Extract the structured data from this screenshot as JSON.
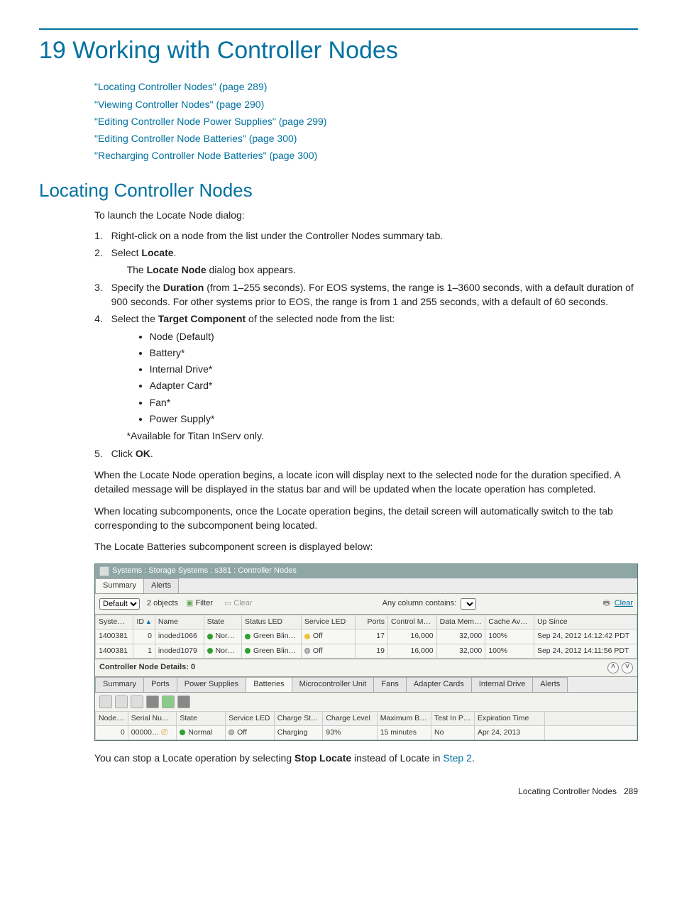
{
  "chapter": {
    "title": "19 Working with Controller Nodes"
  },
  "toc": [
    "\"Locating Controller Nodes\" (page 289)",
    "\"Viewing Controller Nodes\" (page 290)",
    "\"Editing Controller Node Power Supplies\" (page 299)",
    "\"Editing Controller Node Batteries\" (page 300)",
    "\"Recharging Controller Node Batteries\" (page 300)"
  ],
  "section1": {
    "heading": "Locating Controller Nodes",
    "intro": "To launch the Locate Node dialog:",
    "step1": "Right-click on a node from the list under the Controller Nodes summary tab.",
    "step2_pre": "Select ",
    "step2_bold": "Locate",
    "step2_post": ".",
    "step2_sub_pre": "The ",
    "step2_sub_bold": "Locate Node",
    "step2_sub_post": " dialog box appears.",
    "step3_pre": "Specify the ",
    "step3_bold": "Duration",
    "step3_post": " (from 1–255 seconds). For EOS systems, the range is 1–3600 seconds, with a default duration of 900 seconds. For other systems prior to EOS, the range is from 1 and 255 seconds, with a default of 60 seconds.",
    "step4_pre": "Select the ",
    "step4_bold": "Target Component",
    "step4_post": " of the selected node from the list:",
    "bullets": [
      "Node (Default)",
      "Battery*",
      "Internal Drive*",
      "Adapter Card*",
      "Fan*",
      "Power Supply*"
    ],
    "note": "*Available for Titan InServ only.",
    "step5_pre": "Click ",
    "step5_bold": "OK",
    "step5_post": ".",
    "para1": "When the Locate Node operation begins, a locate icon will display next to the selected node for the duration specified. A detailed message will be displayed in the status bar and will be updated when the locate operation has completed.",
    "para2": "When locating subcomponents, once the Locate operation begins, the detail screen will automatically switch to the tab corresponding to the subcomponent being located.",
    "para3": "The Locate Batteries subcomponent screen is displayed below:",
    "closing_pre": "You can stop a Locate operation by selecting ",
    "closing_bold": "Stop Locate",
    "closing_mid": " instead of Locate in ",
    "closing_link": "Step 2",
    "closing_post": "."
  },
  "panel": {
    "breadcrumb": "Systems : Storage Systems : s381 : Controller Nodes",
    "topTabs": [
      "Summary",
      "Alerts"
    ],
    "filter": {
      "dropdown": "Default",
      "count": "2 objects",
      "filterLabel": "Filter",
      "clearLabel": "Clear",
      "searchLabel": "Any column contains:",
      "clearRight": "Clear"
    },
    "topHeaders": [
      "System SN",
      "ID",
      "Name",
      "State",
      "Status LED",
      "Service LED",
      "Ports",
      "Control Memory (GiB)",
      "Data Memory (GiB)",
      "Cache Availability",
      "Up Since"
    ],
    "topRows": [
      {
        "sn": "1400381",
        "id": "0",
        "name": "inoded1066",
        "state": "Normal",
        "status": "Green Blinking",
        "service": "Off",
        "ports": "17",
        "cmem": "16,000",
        "dmem": "32,000",
        "cache": "100%",
        "since": "Sep 24, 2012 14:12:42 PDT",
        "serv_dot": "amber"
      },
      {
        "sn": "1400381",
        "id": "1",
        "name": "inoded1079",
        "state": "Normal",
        "status": "Green Blinking",
        "service": "Off",
        "ports": "19",
        "cmem": "16,000",
        "dmem": "32,000",
        "cache": "100%",
        "since": "Sep 24, 2012 14:11:56 PDT",
        "serv_dot": "grey"
      }
    ],
    "detailsTitle": "Controller Node Details: 0",
    "detailTabs": [
      "Summary",
      "Ports",
      "Power Supplies",
      "Batteries",
      "Microcontroller Unit",
      "Fans",
      "Adapter Cards",
      "Internal Drive",
      "Alerts"
    ],
    "bottomHeaders": [
      "Node ID",
      "Serial Number",
      "State",
      "Service LED",
      "Charge State",
      "Charge Level",
      "Maximum Battery Life",
      "Test In Progress",
      "Expiration Time"
    ],
    "bottomRow": {
      "node": "0",
      "serial": "00000…",
      "state": "Normal",
      "service": "Off",
      "charge": "Charging",
      "level": "93%",
      "maxlife": "15 minutes",
      "test": "No",
      "exp": "Apr 24, 2013"
    }
  },
  "footer": {
    "text": "Locating Controller Nodes",
    "page": "289"
  }
}
